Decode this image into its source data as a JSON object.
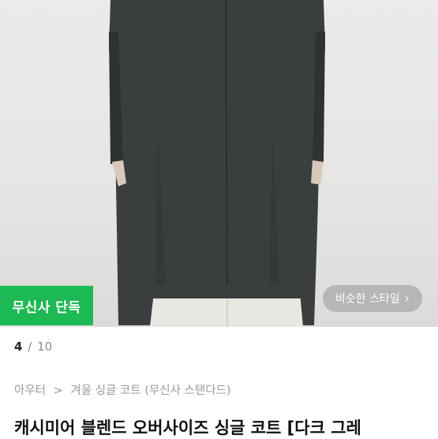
{
  "hero": {
    "image_alt": "dark grey oversized single coat",
    "badge_exclusive": "무신사 단독",
    "similar_style_button": "비슷한 스타일",
    "chevron_icon": "chevron-right-icon"
  },
  "pager": {
    "current": "4",
    "separator": "/",
    "total": "10"
  },
  "breadcrumb": {
    "level1": "아우터",
    "arrow": ">",
    "level2": "겨울 싱글 코트 (무신사 스탠다드)"
  },
  "product": {
    "title": "캐시미어 블렌드 오버사이즈 싱글 코트 [다크 그레"
  },
  "colors": {
    "accent_green": "#1db954",
    "coat": "#3a3d3e"
  }
}
